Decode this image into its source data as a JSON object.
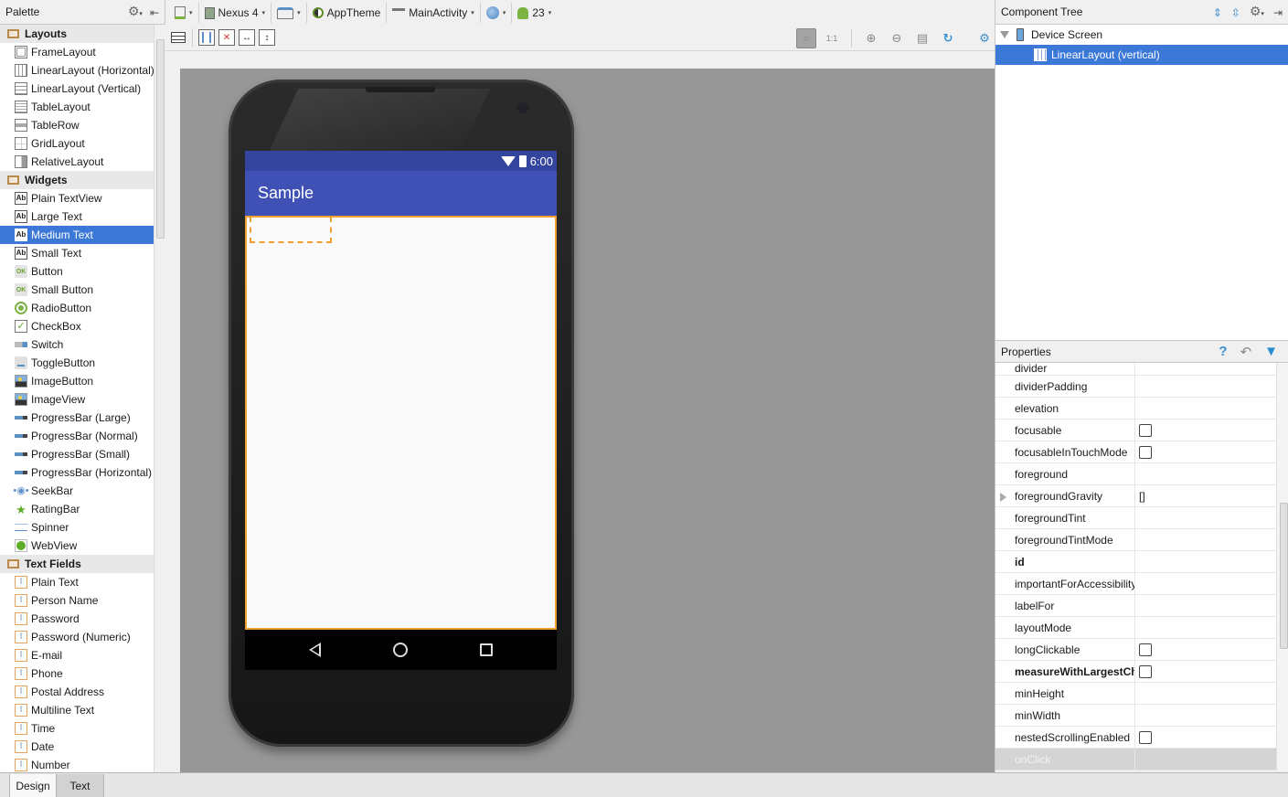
{
  "palette": {
    "title": "Palette",
    "categories": [
      {
        "label": "Layouts",
        "items": [
          {
            "label": "FrameLayout",
            "icon": "frame-layout-icon"
          },
          {
            "label": "LinearLayout (Horizontal)",
            "icon": "linear-layout-horizontal-icon"
          },
          {
            "label": "LinearLayout (Vertical)",
            "icon": "linear-layout-vertical-icon"
          },
          {
            "label": "TableLayout",
            "icon": "table-layout-icon"
          },
          {
            "label": "TableRow",
            "icon": "table-row-icon"
          },
          {
            "label": "GridLayout",
            "icon": "grid-layout-icon"
          },
          {
            "label": "RelativeLayout",
            "icon": "relative-layout-icon"
          }
        ]
      },
      {
        "label": "Widgets",
        "items": [
          {
            "label": "Plain TextView",
            "icon": "textview-icon"
          },
          {
            "label": "Large Text",
            "icon": "textview-icon"
          },
          {
            "label": "Medium Text",
            "icon": "textview-icon",
            "selected": true
          },
          {
            "label": "Small Text",
            "icon": "textview-icon"
          },
          {
            "label": "Button",
            "icon": "button-icon"
          },
          {
            "label": "Small Button",
            "icon": "button-icon"
          },
          {
            "label": "RadioButton",
            "icon": "radio-button-icon"
          },
          {
            "label": "CheckBox",
            "icon": "checkbox-icon"
          },
          {
            "label": "Switch",
            "icon": "switch-icon"
          },
          {
            "label": "ToggleButton",
            "icon": "toggle-button-icon"
          },
          {
            "label": "ImageButton",
            "icon": "image-button-icon"
          },
          {
            "label": "ImageView",
            "icon": "image-view-icon"
          },
          {
            "label": "ProgressBar (Large)",
            "icon": "progress-bar-icon"
          },
          {
            "label": "ProgressBar (Normal)",
            "icon": "progress-bar-icon"
          },
          {
            "label": "ProgressBar (Small)",
            "icon": "progress-bar-icon"
          },
          {
            "label": "ProgressBar (Horizontal)",
            "icon": "progress-bar-icon"
          },
          {
            "label": "SeekBar",
            "icon": "seekbar-icon"
          },
          {
            "label": "RatingBar",
            "icon": "star-icon"
          },
          {
            "label": "Spinner",
            "icon": "spinner-icon"
          },
          {
            "label": "WebView",
            "icon": "globe-icon"
          }
        ]
      },
      {
        "label": "Text Fields",
        "items": [
          {
            "label": "Plain Text",
            "icon": "text-field-icon"
          },
          {
            "label": "Person Name",
            "icon": "text-field-icon"
          },
          {
            "label": "Password",
            "icon": "text-field-icon"
          },
          {
            "label": "Password (Numeric)",
            "icon": "text-field-icon"
          },
          {
            "label": "E-mail",
            "icon": "text-field-icon"
          },
          {
            "label": "Phone",
            "icon": "text-field-icon"
          },
          {
            "label": "Postal Address",
            "icon": "text-field-icon"
          },
          {
            "label": "Multiline Text",
            "icon": "text-field-icon"
          },
          {
            "label": "Time",
            "icon": "text-field-icon"
          },
          {
            "label": "Date",
            "icon": "text-field-icon"
          },
          {
            "label": "Number",
            "icon": "text-field-icon"
          }
        ]
      }
    ]
  },
  "toolbar": {
    "device": "Nexus 4",
    "theme": "AppTheme",
    "activity": "MainActivity",
    "api_level": "23"
  },
  "device_preview": {
    "status_time": "6:00",
    "app_title": "Sample",
    "primary_color": "#3f51b5",
    "status_color": "#3445a0",
    "selection_color": "#f0a030"
  },
  "component_tree": {
    "title": "Component Tree",
    "nodes": [
      {
        "label": "Device Screen"
      },
      {
        "label": "LinearLayout (vertical)",
        "selected": true
      }
    ]
  },
  "properties": {
    "title": "Properties",
    "rows": [
      {
        "name": "divider",
        "value": "",
        "type": "text",
        "partial": true
      },
      {
        "name": "dividerPadding",
        "value": "",
        "type": "text"
      },
      {
        "name": "elevation",
        "value": "",
        "type": "text"
      },
      {
        "name": "focusable",
        "value": false,
        "type": "checkbox"
      },
      {
        "name": "focusableInTouchMode",
        "value": false,
        "type": "checkbox"
      },
      {
        "name": "foreground",
        "value": "",
        "type": "text"
      },
      {
        "name": "foregroundGravity",
        "value": "[]",
        "type": "text",
        "expandable": true
      },
      {
        "name": "foregroundTint",
        "value": "",
        "type": "text"
      },
      {
        "name": "foregroundTintMode",
        "value": "",
        "type": "text"
      },
      {
        "name": "id",
        "value": "",
        "type": "text",
        "bold": true
      },
      {
        "name": "importantForAccessibility",
        "value": "",
        "type": "text"
      },
      {
        "name": "labelFor",
        "value": "",
        "type": "text"
      },
      {
        "name": "layoutMode",
        "value": "",
        "type": "text"
      },
      {
        "name": "longClickable",
        "value": false,
        "type": "checkbox"
      },
      {
        "name": "measureWithLargestChild",
        "value": false,
        "type": "checkbox",
        "bold": true
      },
      {
        "name": "minHeight",
        "value": "",
        "type": "text"
      },
      {
        "name": "minWidth",
        "value": "",
        "type": "text"
      },
      {
        "name": "nestedScrollingEnabled",
        "value": false,
        "type": "checkbox"
      },
      {
        "name": "onClick",
        "value": "",
        "type": "text",
        "disabled": true
      }
    ]
  },
  "bottom_tabs": {
    "design": "Design",
    "text": "Text"
  }
}
